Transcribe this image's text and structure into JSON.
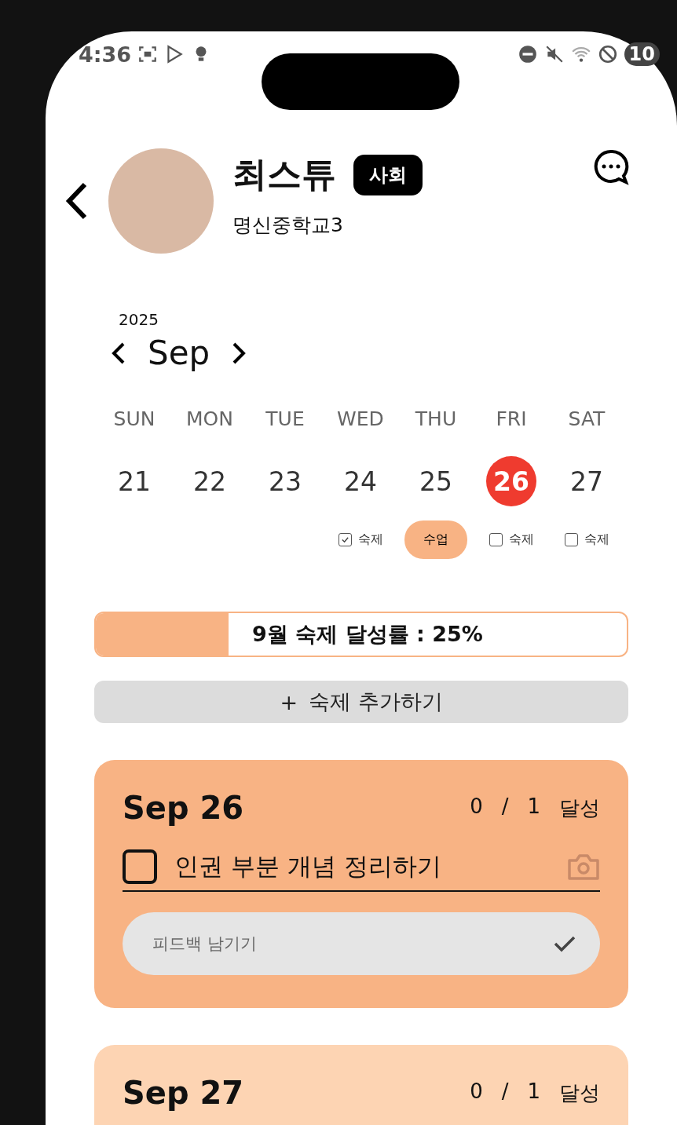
{
  "status_bar": {
    "time": "4:36",
    "battery": "10"
  },
  "profile": {
    "name": "최스튜",
    "subject": "사회",
    "school": "명신중학교3"
  },
  "calendar": {
    "year": "2025",
    "month": "Sep",
    "days": [
      {
        "weekday": "SUN",
        "date": "21",
        "selected": false
      },
      {
        "weekday": "MON",
        "date": "22",
        "selected": false
      },
      {
        "weekday": "TUE",
        "date": "23",
        "selected": false
      },
      {
        "weekday": "WED",
        "date": "24",
        "selected": false,
        "tag": {
          "kind": "checkbox",
          "label": "숙제",
          "checked": true
        }
      },
      {
        "weekday": "THU",
        "date": "25",
        "selected": false,
        "tag": {
          "kind": "pill",
          "label": "수업"
        }
      },
      {
        "weekday": "FRI",
        "date": "26",
        "selected": true,
        "tag": {
          "kind": "checkbox",
          "label": "숙제",
          "checked": false
        }
      },
      {
        "weekday": "SAT",
        "date": "27",
        "selected": false,
        "tag": {
          "kind": "checkbox",
          "label": "숙제",
          "checked": false
        }
      }
    ]
  },
  "progress": {
    "label": "9월 숙제 달성률 : 25%",
    "level": 0.25
  },
  "add_button": {
    "icon": "+",
    "label": "숙제 추가하기"
  },
  "cards": [
    {
      "title": "Sep 26",
      "done": "0",
      "slash": "/",
      "total": "1",
      "status": "달성",
      "color": "#f8b384",
      "tasks": [
        {
          "label": "인권 부분 개념 정리하기",
          "checked": false
        }
      ],
      "feedback": {
        "placeholder": "피드백 남기기"
      }
    },
    {
      "title": "Sep 27",
      "done": "0",
      "slash": "/",
      "total": "1",
      "status": "달성",
      "color": "#fdd4b3"
    }
  ]
}
